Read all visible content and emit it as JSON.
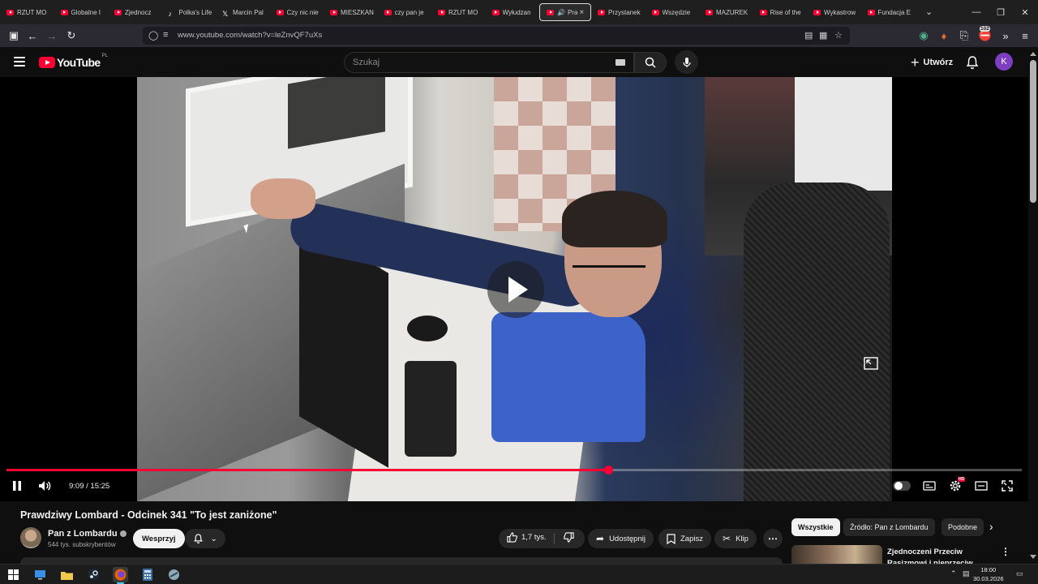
{
  "browser": {
    "tabs": [
      {
        "title": "RZUT MO",
        "icon": "youtube-icon"
      },
      {
        "title": "Globalne I",
        "icon": "youtube-icon"
      },
      {
        "title": "Zjednocz",
        "icon": "youtube-icon"
      },
      {
        "title": "Polka's Life",
        "icon": "tiktok-icon"
      },
      {
        "title": "Marcin Pal",
        "icon": "x-icon"
      },
      {
        "title": "Czy nic nie",
        "icon": "youtube-icon"
      },
      {
        "title": "MIESZKAN",
        "icon": "youtube-icon"
      },
      {
        "title": "czy pan je",
        "icon": "youtube-icon"
      },
      {
        "title": "RZUT MO",
        "icon": "youtube-icon"
      },
      {
        "title": "Wyłudzan",
        "icon": "youtube-icon"
      },
      {
        "title": "Pra",
        "icon": "youtube-icon",
        "active": true
      },
      {
        "title": "Przystanek",
        "icon": "youtube-icon"
      },
      {
        "title": "Wszędzie",
        "icon": "youtube-icon"
      },
      {
        "title": "MAZUREK",
        "icon": "youtube-icon"
      },
      {
        "title": "Rise of the",
        "icon": "youtube-icon"
      },
      {
        "title": "Wykastrow",
        "icon": "youtube-icon"
      },
      {
        "title": "Fundacja E",
        "icon": "youtube-icon"
      }
    ],
    "url": "www.youtube.com/watch?v=leZnvQF7uXs",
    "extensions_badge": "102"
  },
  "youtube": {
    "logo_text": "YouTube",
    "country_code": "PL",
    "search_placeholder": "Szukaj",
    "create_label": "Utwórz",
    "avatar_letter": "K",
    "player": {
      "current_time": "9:09",
      "duration": "15:25",
      "time_display": "9:09 / 15:25",
      "progress_fraction": 0.593,
      "hd_badge": "HD"
    },
    "video": {
      "title": "Prawdziwy Lombard - Odcinek 341 \"To jest zaniżone\"",
      "channel": "Pan z Lombardu",
      "subscribers": "544 tys. subskrybentów",
      "support_label": "Wesprzyj",
      "likes": "1,7 tys.",
      "share_label": "Udostępnij",
      "save_label": "Zapisz",
      "clip_label": "Klip"
    },
    "chips": [
      "Wszystkie",
      "Źródło: Pan z Lombardu",
      "Podobne"
    ],
    "recommendation": {
      "title": "Zjednoczeni Przeciw Rasizmowi i nieprzeciw..."
    }
  },
  "taskbar": {
    "time": "18:00",
    "date": "30.03.2026"
  },
  "colors": {
    "accent": "#ff0033",
    "background": "#0f0f0f",
    "avatar": "#7e3ec1"
  }
}
